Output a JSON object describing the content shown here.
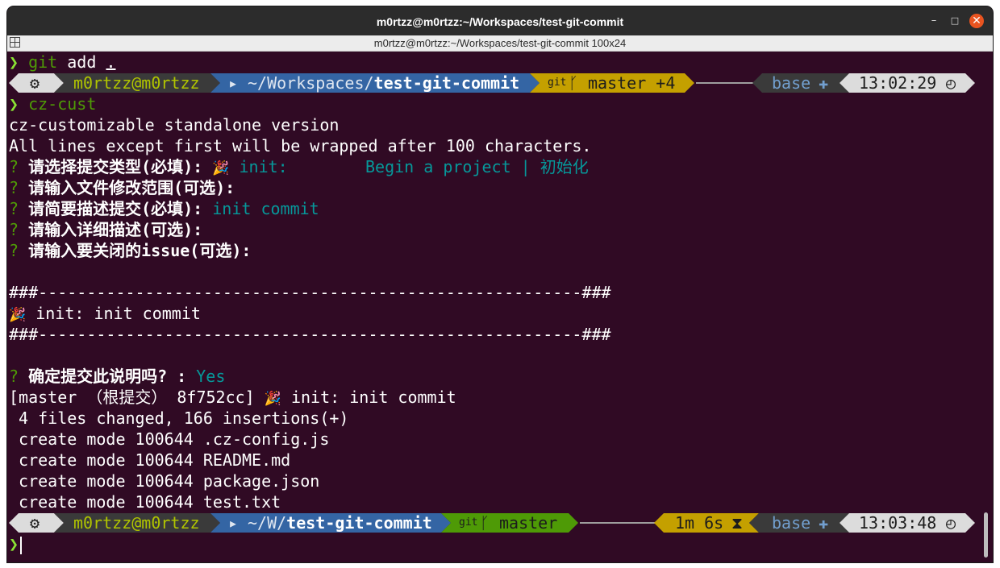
{
  "window": {
    "title": "m0rtzz@m0rtzz:~/Workspaces/test-git-commit",
    "subtitle": "m0rtzz@m0rtzz:~/Workspaces/test-git-commit 100x24",
    "min_icon": "–",
    "max_icon": "□",
    "close_icon": "✕"
  },
  "colors": {
    "background": "#300a24",
    "prompt_user_fg": "#b0c400",
    "prompt_dir_bg": "#3465a4",
    "git_dirty_bg": "#c4a000",
    "git_clean_bg": "#4e9a06",
    "accent_teal": "#06989a",
    "prompt_char": "#8ae234"
  },
  "prompt_glyph": "❯",
  "line0": {
    "cmd": "git",
    "args": " add ",
    "dot": "."
  },
  "prompt1": {
    "os_icon": "⚙",
    "user": "m0rtzz@m0rtzz",
    "dir_icon": "▸",
    "dir_prefix": "~/Workspaces/",
    "dir_name": "test-git-commit",
    "git_label": "git",
    "branch_icon": "ᚴ",
    "branch": "master +4",
    "env": "base",
    "env_icon": "✚",
    "time": "13:02:29",
    "clock_icon": "◴"
  },
  "line2": {
    "cmd": "cz-cust"
  },
  "output": {
    "l3": "cz-customizable standalone version",
    "l4": "All lines except first will be wrapped after 100 characters.",
    "q_mark": "?",
    "q1": "请选择提交类型(必填):",
    "q1_emoji": "🎉",
    "q1_answer": "init:        Begin a project | 初始化",
    "q2": "请输入文件修改范围(可选):",
    "q3": "请简要描述提交(必填):",
    "q3_answer": "init commit",
    "q4": "请输入详细描述(可选):",
    "q5": "请输入要关闭的issue(可选):",
    "sep": "###--------------------------------------------------------###",
    "msg_emoji": "🎉",
    "msg": " init: init commit",
    "confirm": "确定提交此说明吗? :",
    "confirm_answer": "Yes",
    "commit_result_a": "[master （根提交） 8f752cc] ",
    "commit_result_emoji": "🎉",
    "commit_result_b": " init: init commit",
    "files_changed": " 4 files changed, 166 insertions(+)",
    "create_1": " create mode 100644 .cz-config.js",
    "create_2": " create mode 100644 README.md",
    "create_3": " create mode 100644 package.json",
    "create_4": " create mode 100644 test.txt"
  },
  "prompt2": {
    "os_icon": "⚙",
    "user": "m0rtzz@m0rtzz",
    "dir_icon": "▸",
    "dir_prefix": "~/W/",
    "dir_name": "test-git-commit",
    "git_label": "git",
    "branch_icon": "ᚴ",
    "branch": "master",
    "duration": "1m 6s",
    "duration_icon": "⧗",
    "env": "base",
    "env_icon": "✚",
    "time": "13:03:48",
    "clock_icon": "◴"
  }
}
